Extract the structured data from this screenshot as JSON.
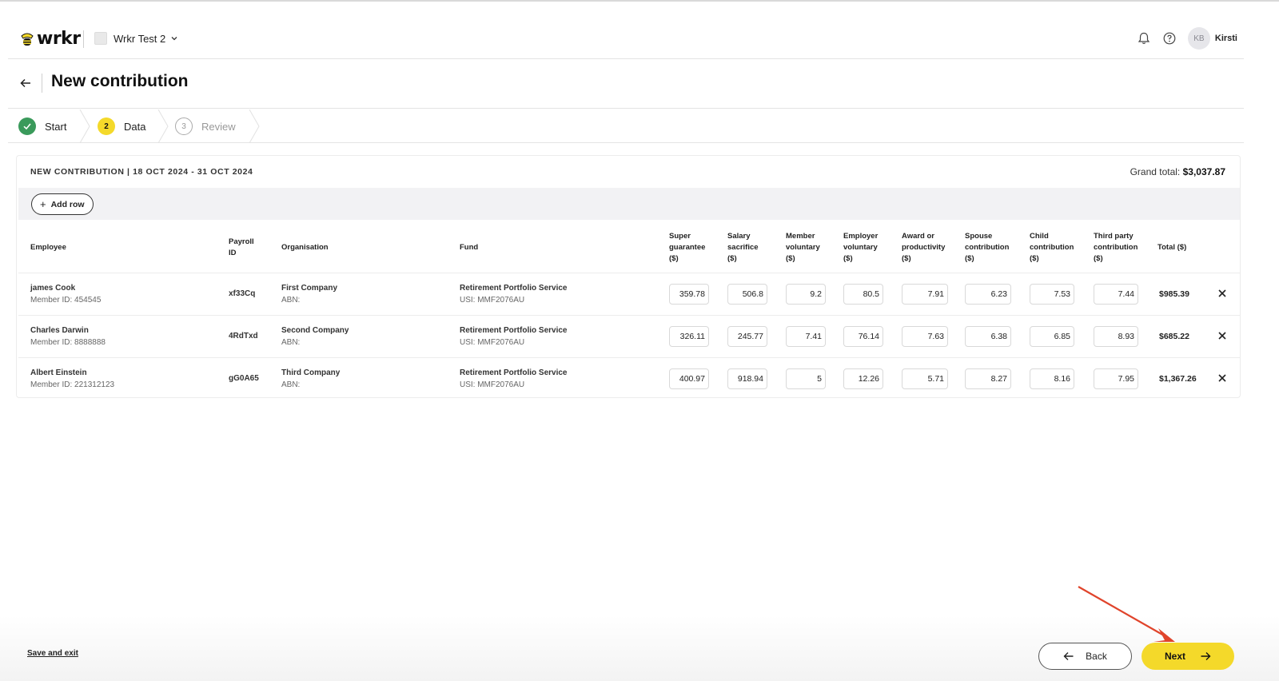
{
  "header": {
    "logo_text": "wrkr",
    "org_name": "Wrkr Test 2",
    "avatar_initials": "KB",
    "user_name": "Kirsti",
    "icons": [
      "bell-icon",
      "help-icon"
    ]
  },
  "title": "New contribution",
  "stepper": {
    "steps": [
      {
        "number": "",
        "label": "Start",
        "state": "complete"
      },
      {
        "number": "2",
        "label": "Data",
        "state": "current"
      },
      {
        "number": "3",
        "label": "Review",
        "state": "upcoming"
      }
    ]
  },
  "card": {
    "title": "NEW CONTRIBUTION | 18 OCT 2024 - 31 OCT 2024",
    "grand_total_label": "Grand total:",
    "grand_total_value": "$3,037.87",
    "add_row_label": "Add row"
  },
  "columns": {
    "employee": "Employee",
    "payroll_id": "Payroll ID",
    "organisation": "Organisation",
    "fund": "Fund",
    "super_guarantee": "Super guarantee ($)",
    "salary_sacrifice": "Salary sacrifice ($)",
    "member_voluntary": "Member voluntary ($)",
    "employer_voluntary": "Employer voluntary ($)",
    "award_productivity": "Award or productivity ($)",
    "spouse_contribution": "Spouse contribution ($)",
    "child_contribution": "Child contribution ($)",
    "third_party": "Third party contribution ($)",
    "total": "Total ($)"
  },
  "rows": [
    {
      "name": "james Cook",
      "member_id": "Member ID: 454545",
      "payroll_id": "xf33Cq",
      "organisation": "First Company",
      "abn": "ABN:",
      "fund": "Retirement Portfolio Service",
      "usi": "USI: MMF2076AU",
      "values": [
        "359.78",
        "506.8",
        "9.2",
        "80.5",
        "7.91",
        "6.23",
        "7.53",
        "7.44"
      ],
      "total": "$985.39"
    },
    {
      "name": "Charles Darwin",
      "member_id": "Member ID: 8888888",
      "payroll_id": "4RdTxd",
      "organisation": "Second Company",
      "abn": "ABN:",
      "fund": "Retirement Portfolio Service",
      "usi": "USI: MMF2076AU",
      "values": [
        "326.11",
        "245.77",
        "7.41",
        "76.14",
        "7.63",
        "6.38",
        "6.85",
        "8.93"
      ],
      "total": "$685.22"
    },
    {
      "name": "Albert Einstein",
      "member_id": "Member ID: 221312123",
      "payroll_id": "gG0A65",
      "organisation": "Third Company",
      "abn": "ABN:",
      "fund": "Retirement Portfolio Service",
      "usi": "USI: MMF2076AU",
      "values": [
        "400.97",
        "918.94",
        "5",
        "12.26",
        "5.71",
        "8.27",
        "8.16",
        "7.95"
      ],
      "total": "$1,367.26"
    }
  ],
  "footer": {
    "save_exit_label": "Save and exit",
    "back_label": "Back",
    "next_label": "Next"
  },
  "colors": {
    "accent_yellow": "#f4d92a",
    "complete_green": "#3a9a5b",
    "annotation_red": "#e0442b"
  }
}
